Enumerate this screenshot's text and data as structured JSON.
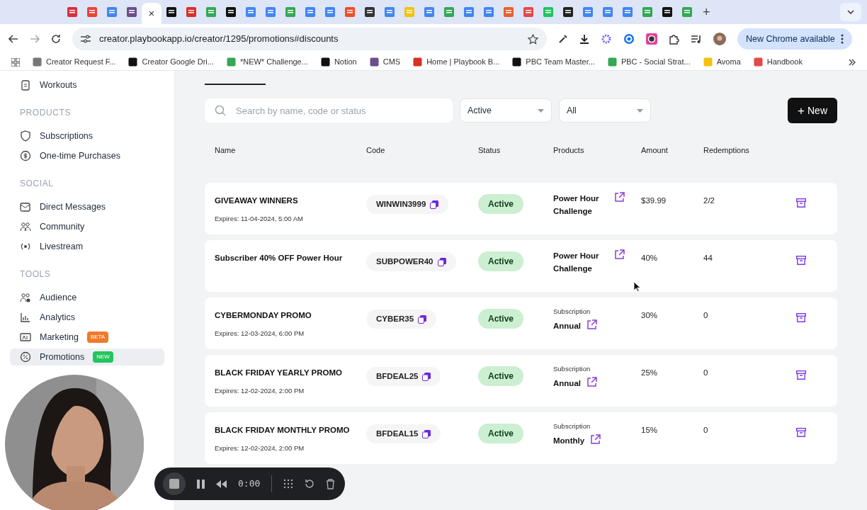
{
  "browser": {
    "tabs": [
      {
        "selected": false
      },
      {
        "selected": false
      },
      {
        "selected": false
      },
      {
        "selected": false
      },
      {
        "selected": true
      },
      {
        "selected": false
      },
      {
        "selected": false
      },
      {
        "selected": false
      },
      {
        "selected": false
      },
      {
        "selected": false
      },
      {
        "selected": false
      },
      {
        "selected": false
      },
      {
        "selected": false
      },
      {
        "selected": false
      },
      {
        "selected": false
      },
      {
        "selected": false
      },
      {
        "selected": false
      },
      {
        "selected": false
      },
      {
        "selected": false
      },
      {
        "selected": false
      },
      {
        "selected": false
      },
      {
        "selected": false
      },
      {
        "selected": false
      },
      {
        "selected": false
      },
      {
        "selected": false
      },
      {
        "selected": false
      },
      {
        "selected": false
      },
      {
        "selected": false
      },
      {
        "selected": false
      },
      {
        "selected": false
      },
      {
        "selected": false
      },
      {
        "selected": false
      }
    ],
    "close_glyph": "×",
    "new_tab_glyph": "+",
    "url": "creator.playbookapp.io/creator/1295/promotions#discounts",
    "update_button": "New Chrome available",
    "bookmarks": [
      "Creator Request F...",
      "Creator Google Dri...",
      "*NEW* Challenge...",
      "Notion",
      "CMS",
      "Home | Playbook B...",
      "PBC Team Master...",
      "PBC - Social Strat...",
      "Avoma",
      "Handbook"
    ]
  },
  "sidebar": {
    "items": [
      {
        "kind": "item",
        "label": "Workouts",
        "selected": false
      },
      {
        "kind": "section",
        "label": "PRODUCTS"
      },
      {
        "kind": "item",
        "label": "Subscriptions",
        "selected": false
      },
      {
        "kind": "item",
        "label": "One-time Purchases",
        "selected": false
      },
      {
        "kind": "section",
        "label": "SOCIAL"
      },
      {
        "kind": "item",
        "label": "Direct Messages",
        "selected": false
      },
      {
        "kind": "item",
        "label": "Community",
        "selected": false
      },
      {
        "kind": "item",
        "label": "Livestream",
        "selected": false
      },
      {
        "kind": "section",
        "label": "TOOLS"
      },
      {
        "kind": "item",
        "label": "Audience",
        "selected": false
      },
      {
        "kind": "item",
        "label": "Analytics",
        "selected": false
      },
      {
        "kind": "item",
        "label": "Marketing",
        "selected": false,
        "badge": "BETA",
        "color": "#f07a2c"
      },
      {
        "kind": "item",
        "label": "Promotions",
        "selected": true,
        "badge": "NEW",
        "color": "#22c55e"
      }
    ]
  },
  "toolbar": {
    "search_placeholder": "Search by name, code or status",
    "status_filter": "Active",
    "product_filter": "All",
    "new_button": "New",
    "new_glyph": "+"
  },
  "table": {
    "columns": [
      "Name",
      "Code",
      "Status",
      "Products",
      "Amount",
      "Redemptions"
    ],
    "rows": [
      {
        "name": "GIVEAWAY WINNERS",
        "expires": "Expires: 11-04-2024, 5:00 AM",
        "code": "WINWIN3999",
        "status": "Active",
        "product": "Power Hour Challenge",
        "amount": "$39.99",
        "redemptions": "2/2"
      },
      {
        "name": "Subscriber 40% OFF Power Hour",
        "code": "SUBPOWER40",
        "status": "Active",
        "product": "Power Hour Challenge",
        "amount": "40%",
        "redemptions": "44"
      },
      {
        "name": "CYBERMONDAY PROMO",
        "expires": "Expires: 12-03-2024, 6:00 PM",
        "code": "CYBER35",
        "status": "Active",
        "product_type": "Subscription",
        "product": "Annual",
        "amount": "30%",
        "redemptions": "0"
      },
      {
        "name": "BLACK FRIDAY YEARLY PROMO",
        "expires": "Expires: 12-02-2024, 2:00 PM",
        "code": "BFDEAL25",
        "status": "Active",
        "product_type": "Subscription",
        "product": "Annual",
        "amount": "25%",
        "redemptions": "0"
      },
      {
        "name": "BLACK FRIDAY MONTHLY PROMO",
        "expires": "Expires: 12-02-2024, 2:00 PM",
        "code": "BFDEAL15",
        "status": "Active",
        "product_type": "Subscription",
        "product": "Monthly",
        "amount": "15%",
        "redemptions": "0"
      }
    ]
  },
  "recorder": {
    "time": "0:00"
  }
}
